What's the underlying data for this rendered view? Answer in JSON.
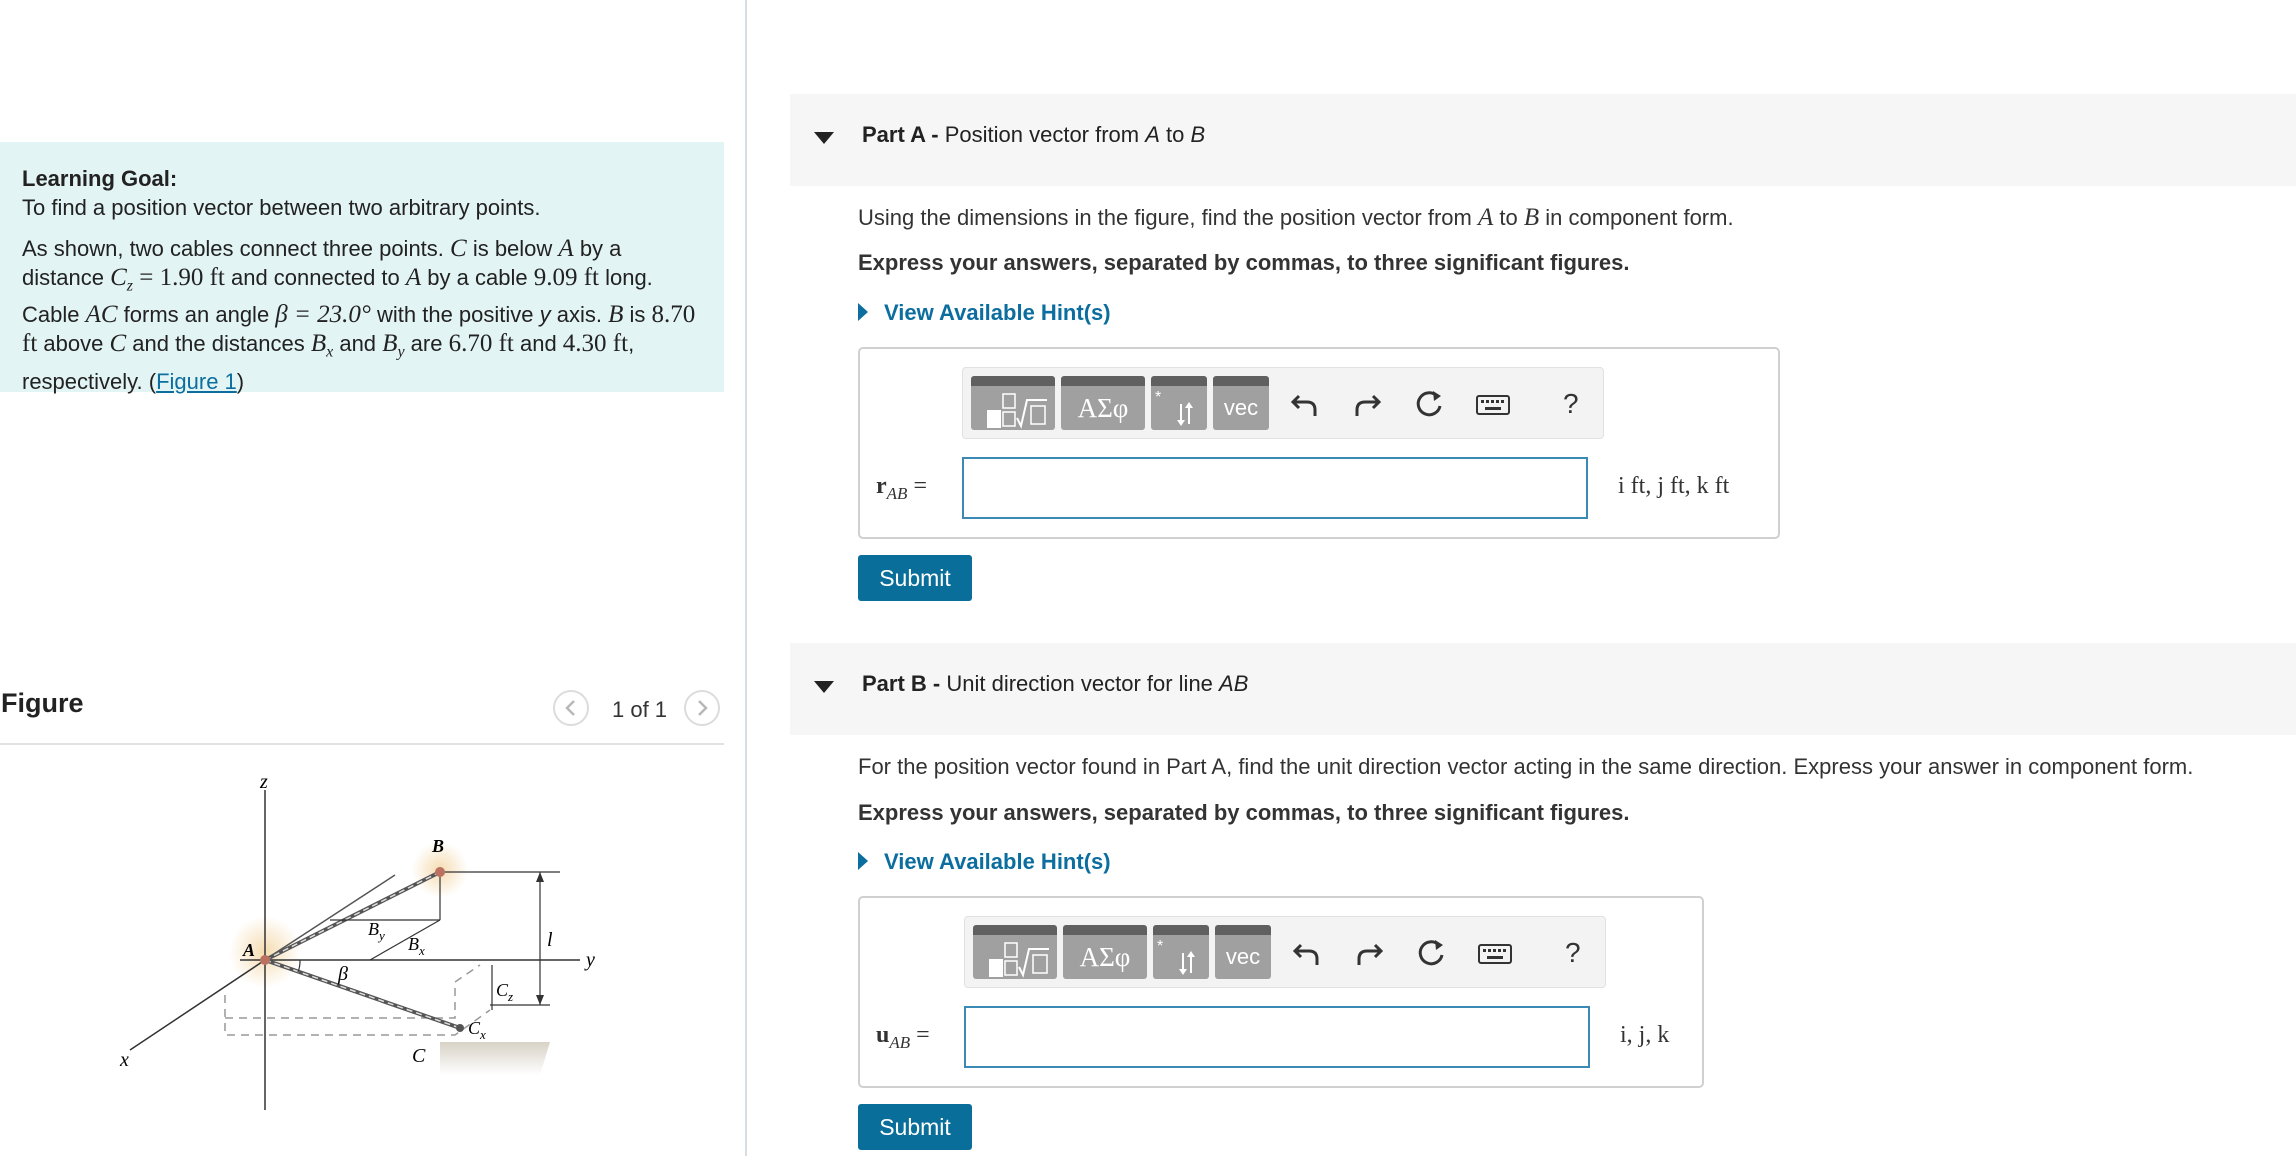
{
  "learning_goal": {
    "title": "Learning Goal:",
    "subtitle": "To find a position vector between two arbitrary points.",
    "t1": "As shown, two cables connect three points. ",
    "C": "C",
    "t2": " is below ",
    "A": "A",
    "t3": " by a distance ",
    "Cz_eq": "C",
    "Cz_sub": "z",
    "Cz_val": " = 1.90 ft",
    "t4": " and connected to ",
    "t5": " by a cable ",
    "cable_len": "9.09 ft",
    "t6": " long. Cable ",
    "AC": "AC",
    "t7": " forms an angle ",
    "beta_eq": "β = 23.0°",
    "t8": " with the positive ",
    "yaxis": "y",
    "t9": " axis. ",
    "B": "B",
    "t10": " is ",
    "l_val": "8.70 ft",
    "t11": " above ",
    "t12": " and the distances ",
    "Bx": "B",
    "Bx_sub": "x",
    "t13": " and ",
    "By": "B",
    "By_sub": "y",
    "t14": " are ",
    "bx_val": "6.70 ft",
    "t15": " and ",
    "by_val": "4.30 ft",
    "t16": ", respectively. (",
    "figure_link": "Figure 1",
    "t17": ")"
  },
  "figure_panel": {
    "title": "Figure",
    "pager": "1 of 1",
    "prev_icon": "chevron-left-icon",
    "next_icon": "chevron-right-icon",
    "labels": {
      "z": "z",
      "y": "y",
      "x": "x",
      "A": "A",
      "B": "B",
      "C": "C",
      "By": "B",
      "By_sub": "y",
      "Bx": "B",
      "Bx_sub": "x",
      "beta": "β",
      "l": "l",
      "Cz": "C",
      "Cz_sub": "z",
      "Cx": "C",
      "Cx_sub": "x"
    }
  },
  "parts": [
    {
      "label": "Part A -",
      "title_pre": " Position vector from ",
      "title_A": "A",
      "title_mid": " to ",
      "title_B": "B",
      "instr_pre": "Using the dimensions in the figure, find the position vector from ",
      "instr_A": "A",
      "instr_mid": " to ",
      "instr_B": "B",
      "instr_post": " in component form.",
      "express": "Express your answers, separated by commas, to three significant figures.",
      "hint": "View Available Hint(s)",
      "answer_label": "r",
      "answer_sub": "AB",
      "answer_eq": " =",
      "answer_value": "",
      "units": "i ft, j ft, k ft",
      "submit": "Submit"
    },
    {
      "label": "Part B -",
      "title_pre": " Unit direction vector for line ",
      "title_AB": "AB",
      "instr": "For the position vector found in Part A, find the unit direction vector acting in the same direction. Express your answer in component form.",
      "express": "Express your answers, separated by commas, to three significant figures.",
      "hint": "View Available Hint(s)",
      "answer_label": "u",
      "answer_sub": "AB",
      "answer_eq": " =",
      "answer_value": "",
      "units": "i, j, k",
      "submit": "Submit"
    }
  ],
  "toolbar": {
    "template_icon": "fraction-sqrt-template-icon",
    "greek": "ΑΣφ",
    "updown_icon": "subscript-superscript-icon",
    "vec": "vec",
    "undo_icon": "undo-icon",
    "redo_icon": "redo-icon",
    "reset_icon": "reset-icon",
    "keyboard_icon": "keyboard-icon",
    "help": "?"
  }
}
